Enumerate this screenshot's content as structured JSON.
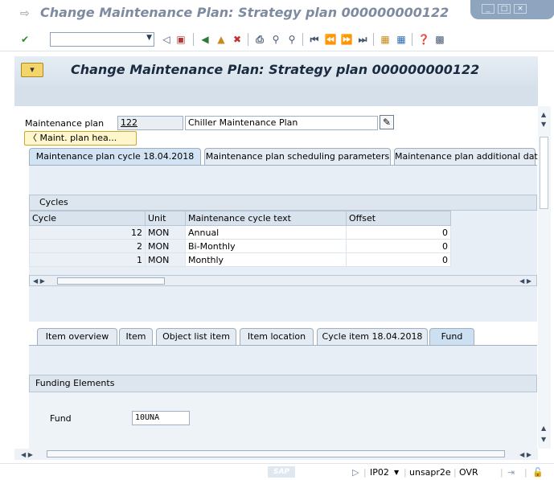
{
  "window": {
    "title": "Change Maintenance Plan: Strategy plan 000000000122"
  },
  "header": {
    "title": "Change Maintenance Plan: Strategy plan 000000000122"
  },
  "form": {
    "plan_label": "Maintenance plan",
    "plan_number": "122",
    "plan_description": "Chiller Maintenance Plan",
    "header_button": "Maint. plan hea..."
  },
  "top_tabs": [
    {
      "label": "Maintenance plan cycle 18.04.2018",
      "active": true
    },
    {
      "label": "Maintenance plan scheduling parameters",
      "active": false
    },
    {
      "label": "Maintenance plan additional data",
      "active": false
    }
  ],
  "cycles": {
    "title": "Cycles",
    "columns": [
      "Cycle",
      "Unit",
      "Maintenance cycle text",
      "Offset"
    ],
    "rows": [
      {
        "cycle": "12",
        "unit": "MON",
        "text": "Annual",
        "offset": "0"
      },
      {
        "cycle": "2",
        "unit": "MON",
        "text": "Bi-Monthly",
        "offset": "0"
      },
      {
        "cycle": "1",
        "unit": "MON",
        "text": "Monthly",
        "offset": "0"
      }
    ]
  },
  "item_tabs": [
    {
      "label": "Item overview",
      "active": false
    },
    {
      "label": "Item",
      "active": false
    },
    {
      "label": "Object list item",
      "active": false
    },
    {
      "label": "Item location",
      "active": false
    },
    {
      "label": "Cycle item 18.04.2018",
      "active": false
    },
    {
      "label": "Fund",
      "active": true
    }
  ],
  "funding": {
    "title": "Funding Elements",
    "fund_label": "Fund",
    "fund_value": "10UNA"
  },
  "status": {
    "logo": "SAP",
    "system": "IP02",
    "client_user": "unsapr2e",
    "mode": "OVR"
  },
  "colors": {
    "accent": "#d2e4f3",
    "panel": "#e7eef5",
    "header": "#d8e2ec"
  }
}
